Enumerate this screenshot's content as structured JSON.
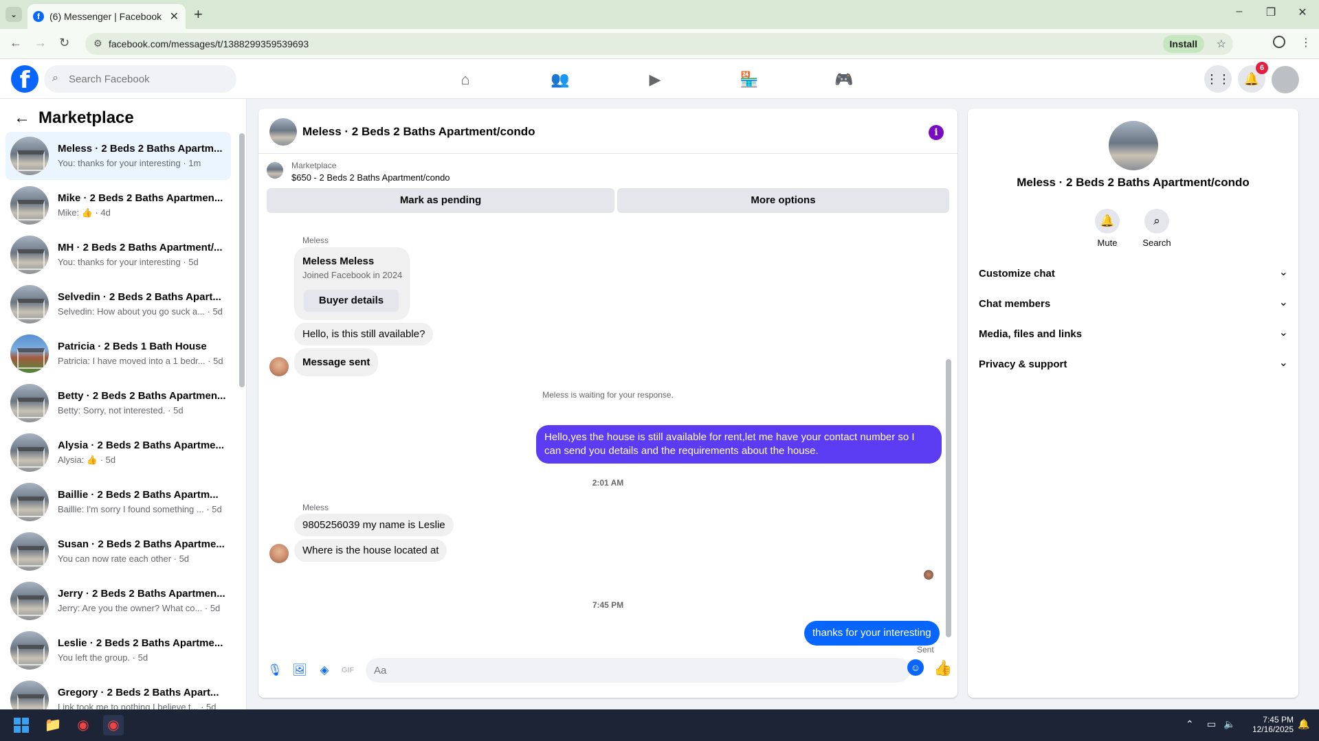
{
  "browser": {
    "tab_title": "(6) Messenger | Facebook",
    "url": "facebook.com/messages/t/1388299359539693",
    "install_label": "Install"
  },
  "header": {
    "search_placeholder": "Search Facebook",
    "notification_count": "6",
    "nav_icons": [
      "home-icon",
      "friends-icon",
      "video-icon",
      "marketplace-icon",
      "gaming-icon"
    ]
  },
  "sidebar": {
    "title": "Marketplace",
    "conversations": [
      {
        "name": "Meless · 2 Beds 2 Baths Apartm...",
        "preview": "You: thanks for your interesting · 1m",
        "active": true
      },
      {
        "name": "Mike · 2 Beds 2 Baths Apartmen...",
        "preview": "Mike: 👍 · 4d"
      },
      {
        "name": "MH · 2 Beds 2 Baths Apartment/...",
        "preview": "You: thanks for your interesting · 5d"
      },
      {
        "name": "Selvedin · 2 Beds 2 Baths Apart...",
        "preview": "Selvedin: How about you go suck a... · 5d"
      },
      {
        "name": "Patricia · 2 Beds 1 Bath House",
        "preview": "Patricia: I have moved into a 1 bedr... · 5d"
      },
      {
        "name": "Betty · 2 Beds 2 Baths Apartmen...",
        "preview": "Betty: Sorry, not interested. · 5d"
      },
      {
        "name": "Alysia · 2 Beds 2 Baths Apartme...",
        "preview": "Alysia: 👍 · 5d"
      },
      {
        "name": "Baillie · 2 Beds 2 Baths Apartm...",
        "preview": "Baillie: I'm sorry I found something ... · 5d"
      },
      {
        "name": "Susan · 2 Beds 2 Baths Apartme...",
        "preview": "You can now rate each other · 5d"
      },
      {
        "name": "Jerry · 2 Beds 2 Baths Apartmen...",
        "preview": "Jerry: Are you the owner? What co... · 5d"
      },
      {
        "name": "Leslie · 2 Beds 2 Baths Apartme...",
        "preview": "You left the group. · 5d"
      },
      {
        "name": "Gregory · 2 Beds 2 Baths Apart...",
        "preview": "Link took me to nothing I believe t... · 5d"
      }
    ]
  },
  "chat": {
    "title": "Meless · 2 Beds 2 Baths Apartment/condo",
    "marketplace_label": "Marketplace",
    "listing": "$650 - 2 Beds 2 Baths Apartment/condo",
    "mark_pending": "Mark as pending",
    "more_options": "More options",
    "sender_name": "Meless",
    "card_name": "Meless Meless",
    "card_sub": "Joined Facebook in 2024",
    "buyer_details": "Buyer details",
    "msg1": "Hello, is this still available?",
    "msg2": "Message sent",
    "waiting": "Meless is waiting for your response.",
    "out1": "Hello,yes the house is still available for rent,let me have your contact number   so I can send you details and the requirements about the house.",
    "time1": "2:01 AM",
    "sender_name2": "Meless",
    "msg3": "9805256039 my name is Leslie",
    "msg4": "Where is the house located at",
    "time2": "7:45 PM",
    "out2": "thanks for your interesting",
    "sent": "Sent",
    "composer_placeholder": "Aa",
    "out_color": "#5b3cf2",
    "out_color2": "#0866ff"
  },
  "details": {
    "name": "Meless · 2 Beds 2 Baths Apartment/condo",
    "mute": "Mute",
    "search": "Search",
    "sections": [
      "Customize chat",
      "Chat members",
      "Media, files and links",
      "Privacy & support"
    ]
  },
  "taskbar": {
    "time": "7:45 PM",
    "date": "12/16/2025"
  }
}
